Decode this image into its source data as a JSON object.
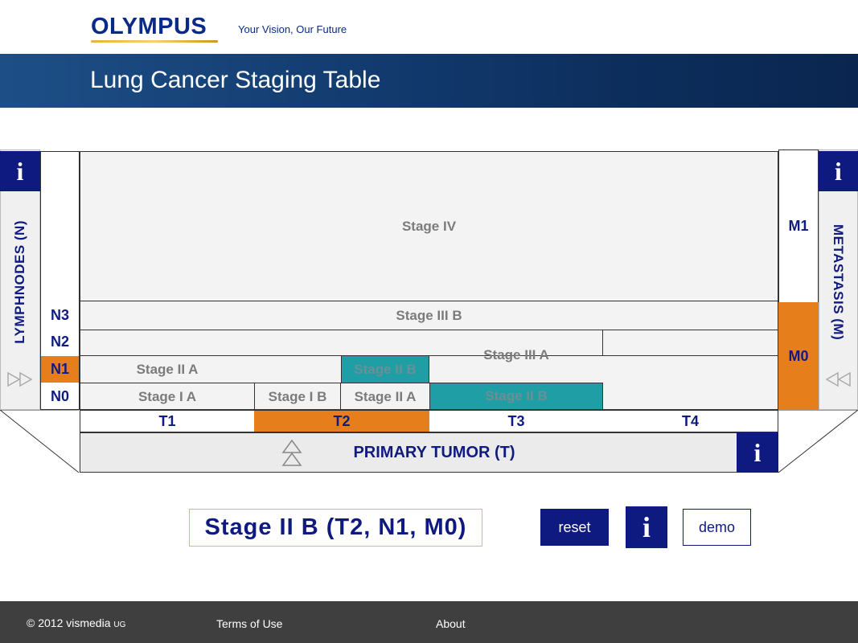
{
  "brand": {
    "logo": "OLYMPUS",
    "tagline": "Your Vision, Our Future"
  },
  "page": {
    "title": "Lung Cancer Staging Table"
  },
  "axes": {
    "n_label": "LYMPHNODES (N)",
    "m_label": "METASTASIS (M)",
    "t_label": "PRIMARY TUMOR (T)",
    "info": "i"
  },
  "n_rows": [
    "N3",
    "N2",
    "N1",
    "N0"
  ],
  "m_rows": [
    "M1",
    "M0"
  ],
  "t_cols": [
    "T1",
    "T2",
    "T3",
    "T4"
  ],
  "selected": {
    "t": "T2",
    "n": "N1",
    "m": "M0"
  },
  "stages": {
    "stage_iv": "Stage IV",
    "stage_iiib": "Stage III B",
    "stage_iiia": "Stage III A",
    "stage_iia_n1": "Stage II A",
    "stage_iib_n1": "Stage II B",
    "stage_ia": "Stage I A",
    "stage_ib": "Stage I B",
    "stage_iia_n0": "Stage II A",
    "stage_iib_n0": "Stage II B"
  },
  "result": {
    "text": "Stage II B (T2, N1, M0)"
  },
  "controls": {
    "reset": "reset",
    "info": "i",
    "demo": "demo"
  },
  "footer": {
    "copyright": "© 2012 vismedia",
    "copyright_suffix": "UG",
    "terms": "Terms of Use",
    "about": "About"
  },
  "colors": {
    "navy": "#0f1a80",
    "orange": "#e67e1b",
    "teal": "#1f9fa5",
    "banner": "#123a6e"
  }
}
